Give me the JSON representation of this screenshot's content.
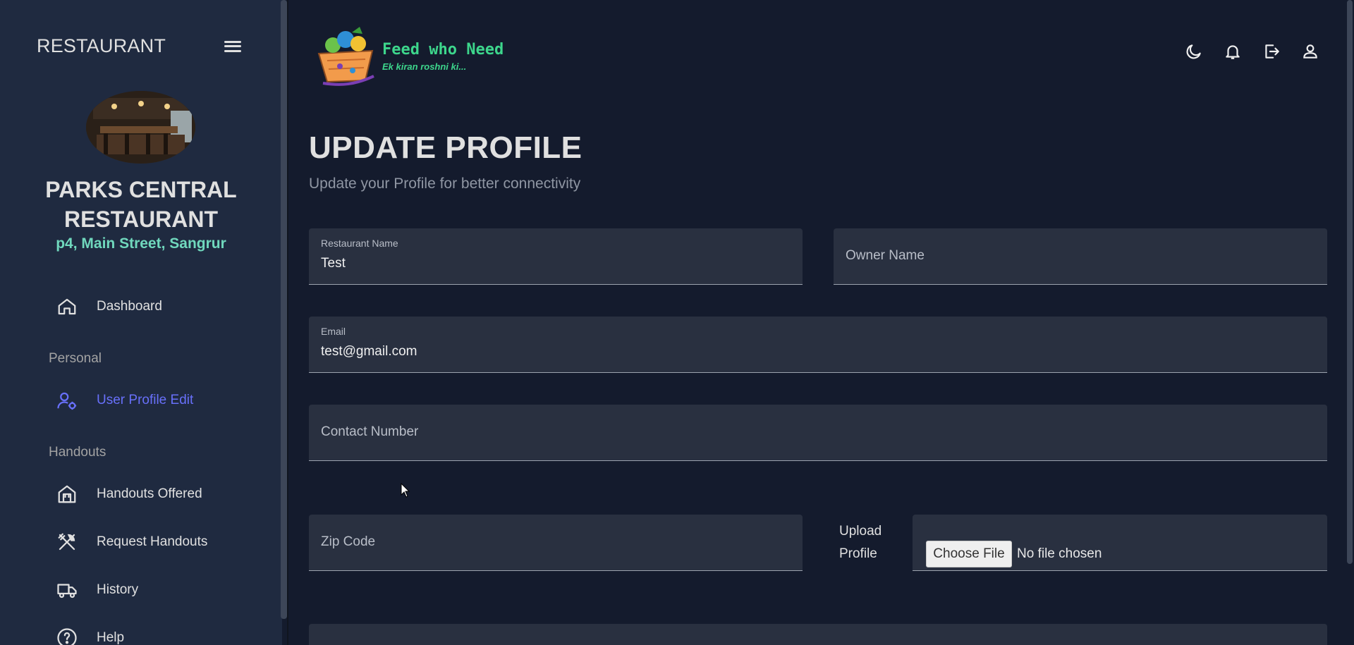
{
  "sidebar": {
    "brand": "RESTAURANT",
    "org_name_line1": "PARKS CENTRAL",
    "org_name_line2": "RESTAURANT",
    "address": "p4, Main Street, Sangrur",
    "items": [
      {
        "label": "Dashboard",
        "icon": "home-icon"
      },
      {
        "label": "User Profile Edit",
        "icon": "user-settings-icon",
        "active": true
      },
      {
        "label": "Handouts Offered",
        "icon": "store-icon"
      },
      {
        "label": "Request Handouts",
        "icon": "utensils-icon"
      },
      {
        "label": "History",
        "icon": "truck-icon"
      },
      {
        "label": "Help",
        "icon": "help-icon"
      }
    ],
    "sections": [
      "Personal",
      "Handouts"
    ]
  },
  "header": {
    "logo_title": "Feed who Need",
    "logo_tagline": "Ek kiran roshni ki...",
    "icons": [
      "moon-icon",
      "bell-icon",
      "logout-icon",
      "user-icon"
    ]
  },
  "page": {
    "title": "UPDATE PROFILE",
    "subtitle": "Update your Profile for better connectivity"
  },
  "form": {
    "restaurant_name": {
      "label": "Restaurant Name",
      "value": "Test"
    },
    "owner_name": {
      "placeholder": "Owner Name"
    },
    "email": {
      "label": "Email",
      "value": "test@gmail.com"
    },
    "contact_number": {
      "placeholder": "Contact Number"
    },
    "zip_code": {
      "placeholder": "Zip Code"
    },
    "upload_label_line1": "Upload",
    "upload_label_line2": "Profile",
    "choose_file": "Choose File",
    "file_status": "No file chosen"
  },
  "colors": {
    "background": "#141b2d",
    "sidebar": "#1f2a40",
    "accent_green": "#70d8bd",
    "active_blue": "#6870fa",
    "field_bg": "#293040"
  }
}
